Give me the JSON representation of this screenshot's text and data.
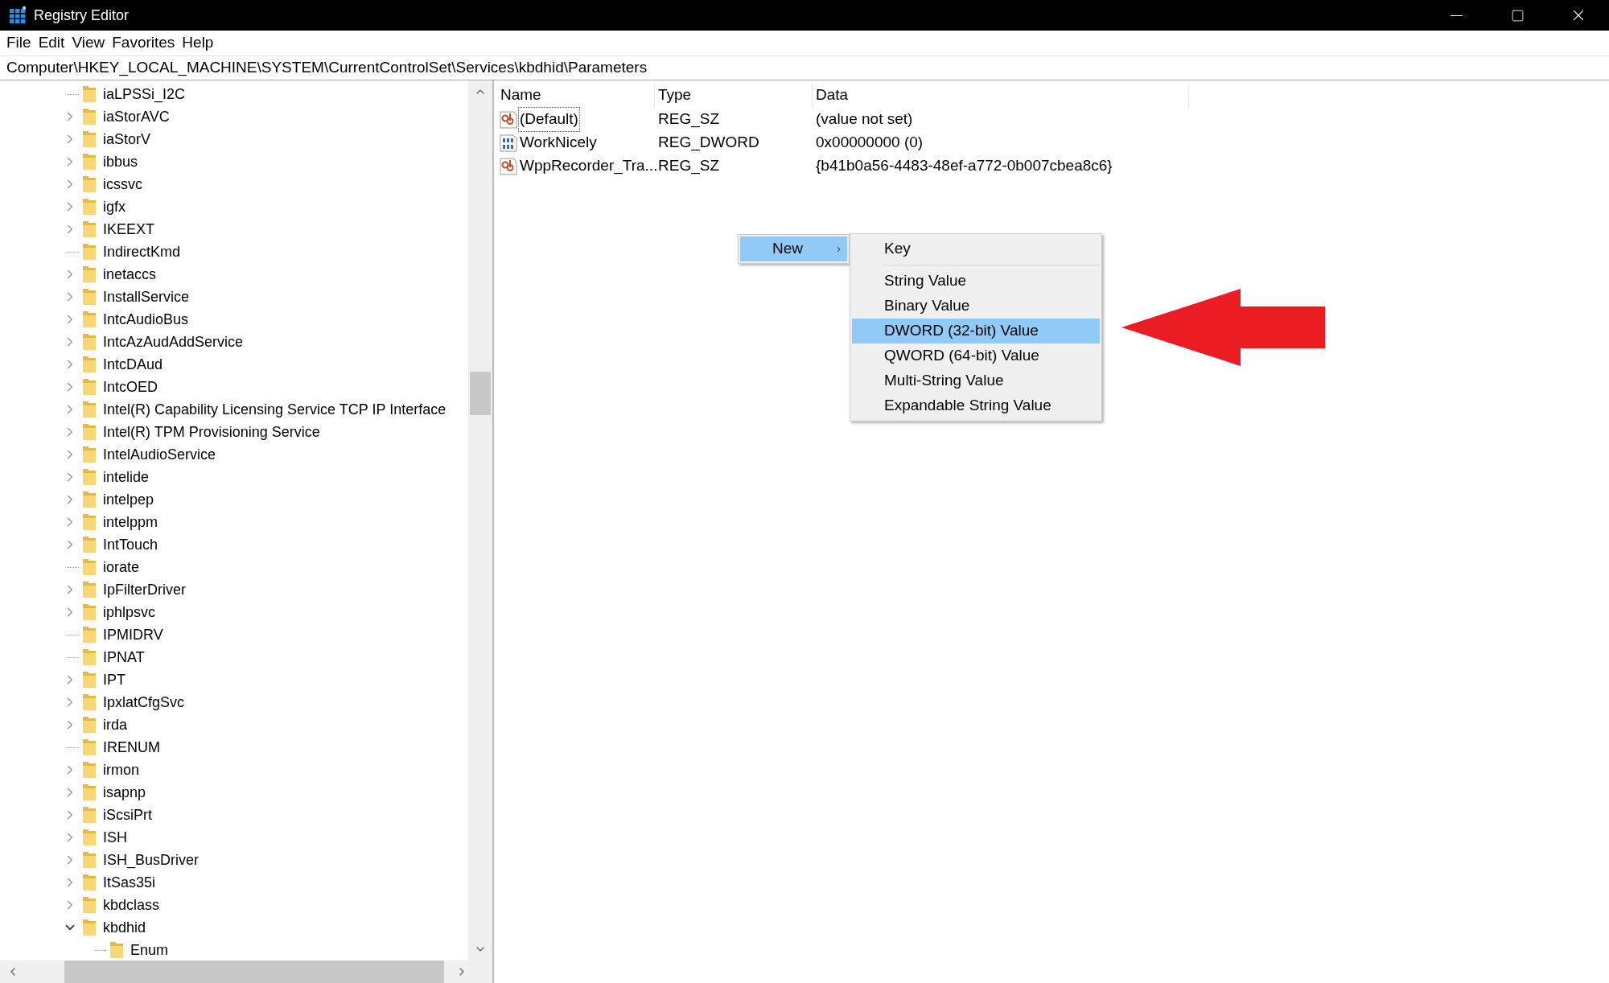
{
  "window": {
    "title": "Registry Editor"
  },
  "menu_bar": [
    "File",
    "Edit",
    "View",
    "Favorites",
    "Help"
  ],
  "address_bar": {
    "value": "Computer\\HKEY_LOCAL_MACHINE\\SYSTEM\\CurrentControlSet\\Services\\kbdhid\\Parameters"
  },
  "tree": {
    "items": [
      {
        "label": "iaLPSSi_I2C",
        "kind": "leaf",
        "expanded": false
      },
      {
        "label": "iaStorAVC",
        "kind": "branch",
        "expanded": false
      },
      {
        "label": "iaStorV",
        "kind": "branch",
        "expanded": false
      },
      {
        "label": "ibbus",
        "kind": "branch",
        "expanded": false
      },
      {
        "label": "icssvc",
        "kind": "branch",
        "expanded": false
      },
      {
        "label": "igfx",
        "kind": "branch",
        "expanded": false
      },
      {
        "label": "IKEEXT",
        "kind": "branch",
        "expanded": false
      },
      {
        "label": "IndirectKmd",
        "kind": "leaf",
        "expanded": false
      },
      {
        "label": "inetaccs",
        "kind": "branch",
        "expanded": false
      },
      {
        "label": "InstallService",
        "kind": "branch",
        "expanded": false
      },
      {
        "label": "IntcAudioBus",
        "kind": "branch",
        "expanded": false
      },
      {
        "label": "IntcAzAudAddService",
        "kind": "branch",
        "expanded": false
      },
      {
        "label": "IntcDAud",
        "kind": "branch",
        "expanded": false
      },
      {
        "label": "IntcOED",
        "kind": "branch",
        "expanded": false
      },
      {
        "label": "Intel(R) Capability Licensing Service TCP IP Interface",
        "kind": "branch",
        "expanded": false
      },
      {
        "label": "Intel(R) TPM Provisioning Service",
        "kind": "branch",
        "expanded": false
      },
      {
        "label": "IntelAudioService",
        "kind": "branch",
        "expanded": false
      },
      {
        "label": "intelide",
        "kind": "branch",
        "expanded": false
      },
      {
        "label": "intelpep",
        "kind": "branch",
        "expanded": false
      },
      {
        "label": "intelppm",
        "kind": "branch",
        "expanded": false
      },
      {
        "label": "IntTouch",
        "kind": "branch",
        "expanded": false
      },
      {
        "label": "iorate",
        "kind": "leaf",
        "expanded": false
      },
      {
        "label": "IpFilterDriver",
        "kind": "branch",
        "expanded": false
      },
      {
        "label": "iphlpsvc",
        "kind": "branch",
        "expanded": false
      },
      {
        "label": "IPMIDRV",
        "kind": "leaf",
        "expanded": false
      },
      {
        "label": "IPNAT",
        "kind": "leaf",
        "expanded": false
      },
      {
        "label": "IPT",
        "kind": "branch",
        "expanded": false
      },
      {
        "label": "IpxlatCfgSvc",
        "kind": "branch",
        "expanded": false
      },
      {
        "label": "irda",
        "kind": "branch",
        "expanded": false
      },
      {
        "label": "IRENUM",
        "kind": "leaf",
        "expanded": false
      },
      {
        "label": "irmon",
        "kind": "branch",
        "expanded": false
      },
      {
        "label": "isapnp",
        "kind": "branch",
        "expanded": false
      },
      {
        "label": "iScsiPrt",
        "kind": "branch",
        "expanded": false
      },
      {
        "label": "ISH",
        "kind": "branch",
        "expanded": false
      },
      {
        "label": "ISH_BusDriver",
        "kind": "branch",
        "expanded": false
      },
      {
        "label": "ItSas35i",
        "kind": "branch",
        "expanded": false
      },
      {
        "label": "kbdclass",
        "kind": "branch",
        "expanded": false
      },
      {
        "label": "kbdhid",
        "expanded": true,
        "children": [
          {
            "label": "Enum",
            "kind": "leaf",
            "expanded": false
          }
        ]
      }
    ]
  },
  "values_table": {
    "columns": [
      "Name",
      "Type",
      "Data"
    ],
    "rows": [
      {
        "kind": "string",
        "name": "(Default)",
        "type": "REG_SZ",
        "data": "(value not set)",
        "focused": true
      },
      {
        "kind": "binary",
        "name": "WorkNicely",
        "type": "REG_DWORD",
        "data": "0x00000000 (0)",
        "focused": false
      },
      {
        "kind": "string",
        "name": "WppRecorder_Tra...",
        "type": "REG_SZ",
        "data": "{b41b0a56-4483-48ef-a772-0b007cbea8c6}",
        "focused": false
      }
    ]
  },
  "context_menu": {
    "items": [
      {
        "label": "New",
        "selected": true,
        "arrow": "›",
        "submenu": {
          "groups": [
            [
              {
                "label": "Key",
                "selected": false
              }
            ],
            [
              {
                "label": "String Value",
                "selected": false
              },
              {
                "label": "Binary Value",
                "selected": false
              },
              {
                "label": "DWORD (32-bit) Value",
                "selected": true
              },
              {
                "label": "QWORD (64-bit) Value",
                "selected": false
              },
              {
                "label": "Multi-String Value",
                "selected": false
              },
              {
                "label": "Expandable String Value",
                "selected": false
              }
            ]
          ]
        }
      }
    ]
  }
}
